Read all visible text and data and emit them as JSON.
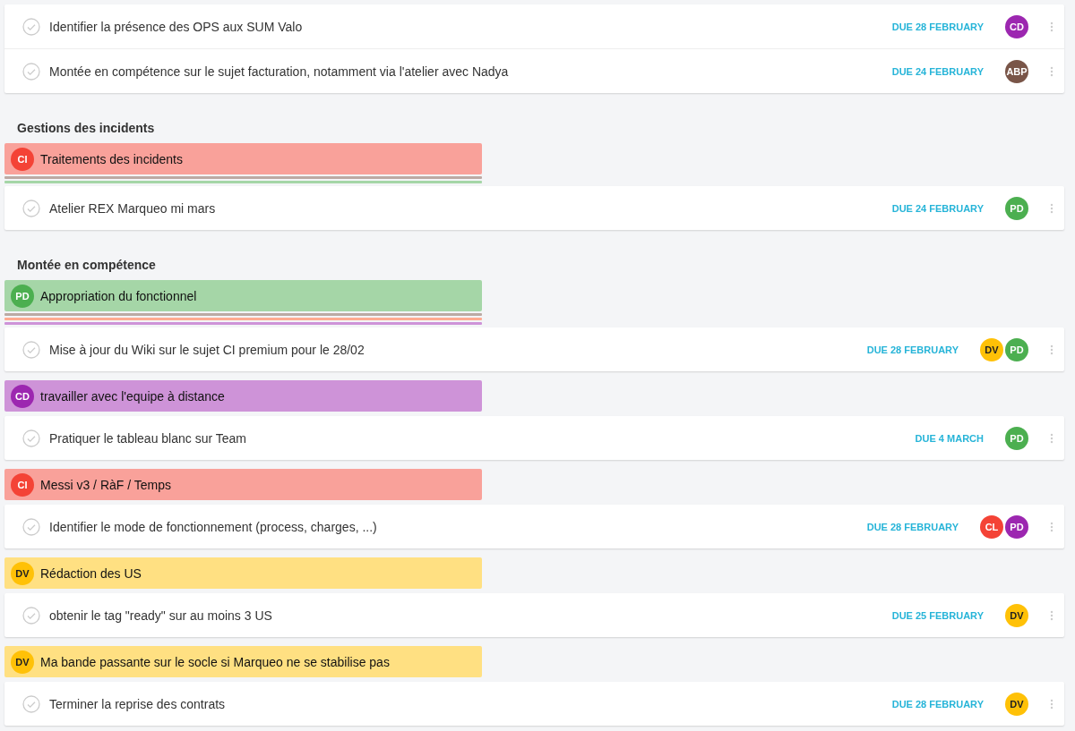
{
  "top_tasks": [
    {
      "title": "Identifier la présence des OPS aux SUM Valo",
      "due": "DUE 28 FEBRUARY",
      "assignees": [
        {
          "initials": "CD",
          "color": "#9c27b0"
        }
      ]
    },
    {
      "title": "Montée en compétence sur le sujet facturation, notamment via l'atelier avec Nadya",
      "due": "DUE 24 FEBRUARY",
      "assignees": [
        {
          "initials": "ABP",
          "color": "#795548"
        }
      ]
    }
  ],
  "sections": [
    {
      "heading": "Gestions des incidents",
      "objectives": [
        {
          "title": "Traitements des incidents",
          "color": "#f9a19a",
          "owner": {
            "initials": "CI",
            "color": "#f44336"
          },
          "stripes": [
            {
              "color": "#bcaaa4"
            },
            {
              "color": "#a5d6a7"
            }
          ],
          "tasks": [
            {
              "title": "Atelier REX Marqueo mi mars",
              "due": "DUE 24 FEBRUARY",
              "assignees": [
                {
                  "initials": "PD",
                  "color": "#4caf50"
                }
              ]
            }
          ]
        }
      ]
    },
    {
      "heading": "Montée en compétence",
      "objectives": [
        {
          "title": "Appropriation du fonctionnel",
          "color": "#a5d6a7",
          "owner": {
            "initials": "PD",
            "color": "#4caf50"
          },
          "stripes": [
            {
              "color": "#bcaaa4"
            },
            {
              "color": "#ffab91"
            },
            {
              "color": "#ce93d8"
            }
          ],
          "tasks": [
            {
              "title": "Mise à jour du Wiki sur le sujet CI premium pour le 28/02",
              "due": "DUE 28 FEBRUARY",
              "assignees": [
                {
                  "initials": "DV",
                  "color": "#ffc107"
                },
                {
                  "initials": "PD",
                  "color": "#4caf50"
                }
              ]
            }
          ]
        },
        {
          "title": "travailler avec l'equipe à distance",
          "color": "#ce93d8",
          "owner": {
            "initials": "CD",
            "color": "#9c27b0"
          },
          "tasks": [
            {
              "title": "Pratiquer le tableau blanc sur Team",
              "due": "DUE 4 MARCH",
              "assignees": [
                {
                  "initials": "PD",
                  "color": "#4caf50"
                }
              ]
            }
          ]
        },
        {
          "title": "Messi v3 / RàF / Temps",
          "color": "#f9a19a",
          "owner": {
            "initials": "CI",
            "color": "#f44336"
          },
          "tasks": [
            {
              "title": "Identifier le mode de fonctionnement (process, charges, ...)",
              "due": "DUE 28 FEBRUARY",
              "assignees": [
                {
                  "initials": "CL",
                  "color": "#f44336"
                },
                {
                  "initials": "PD",
                  "color": "#9c27b0"
                }
              ]
            }
          ]
        },
        {
          "title": "Rédaction des US",
          "color": "#ffe082",
          "owner": {
            "initials": "DV",
            "color": "#ffc107"
          },
          "tasks": [
            {
              "title": "obtenir le tag \"ready\" sur au moins 3 US",
              "due": "DUE 25 FEBRUARY",
              "assignees": [
                {
                  "initials": "DV",
                  "color": "#ffc107"
                }
              ]
            }
          ]
        },
        {
          "title": "Ma bande passante sur le socle si Marqueo ne se stabilise pas",
          "color": "#ffe082",
          "owner": {
            "initials": "DV",
            "color": "#ffc107"
          },
          "tasks": [
            {
              "title": "Terminer la reprise des contrats",
              "due": "DUE 28 FEBRUARY",
              "assignees": [
                {
                  "initials": "DV",
                  "color": "#ffc107"
                }
              ]
            }
          ]
        }
      ]
    }
  ]
}
